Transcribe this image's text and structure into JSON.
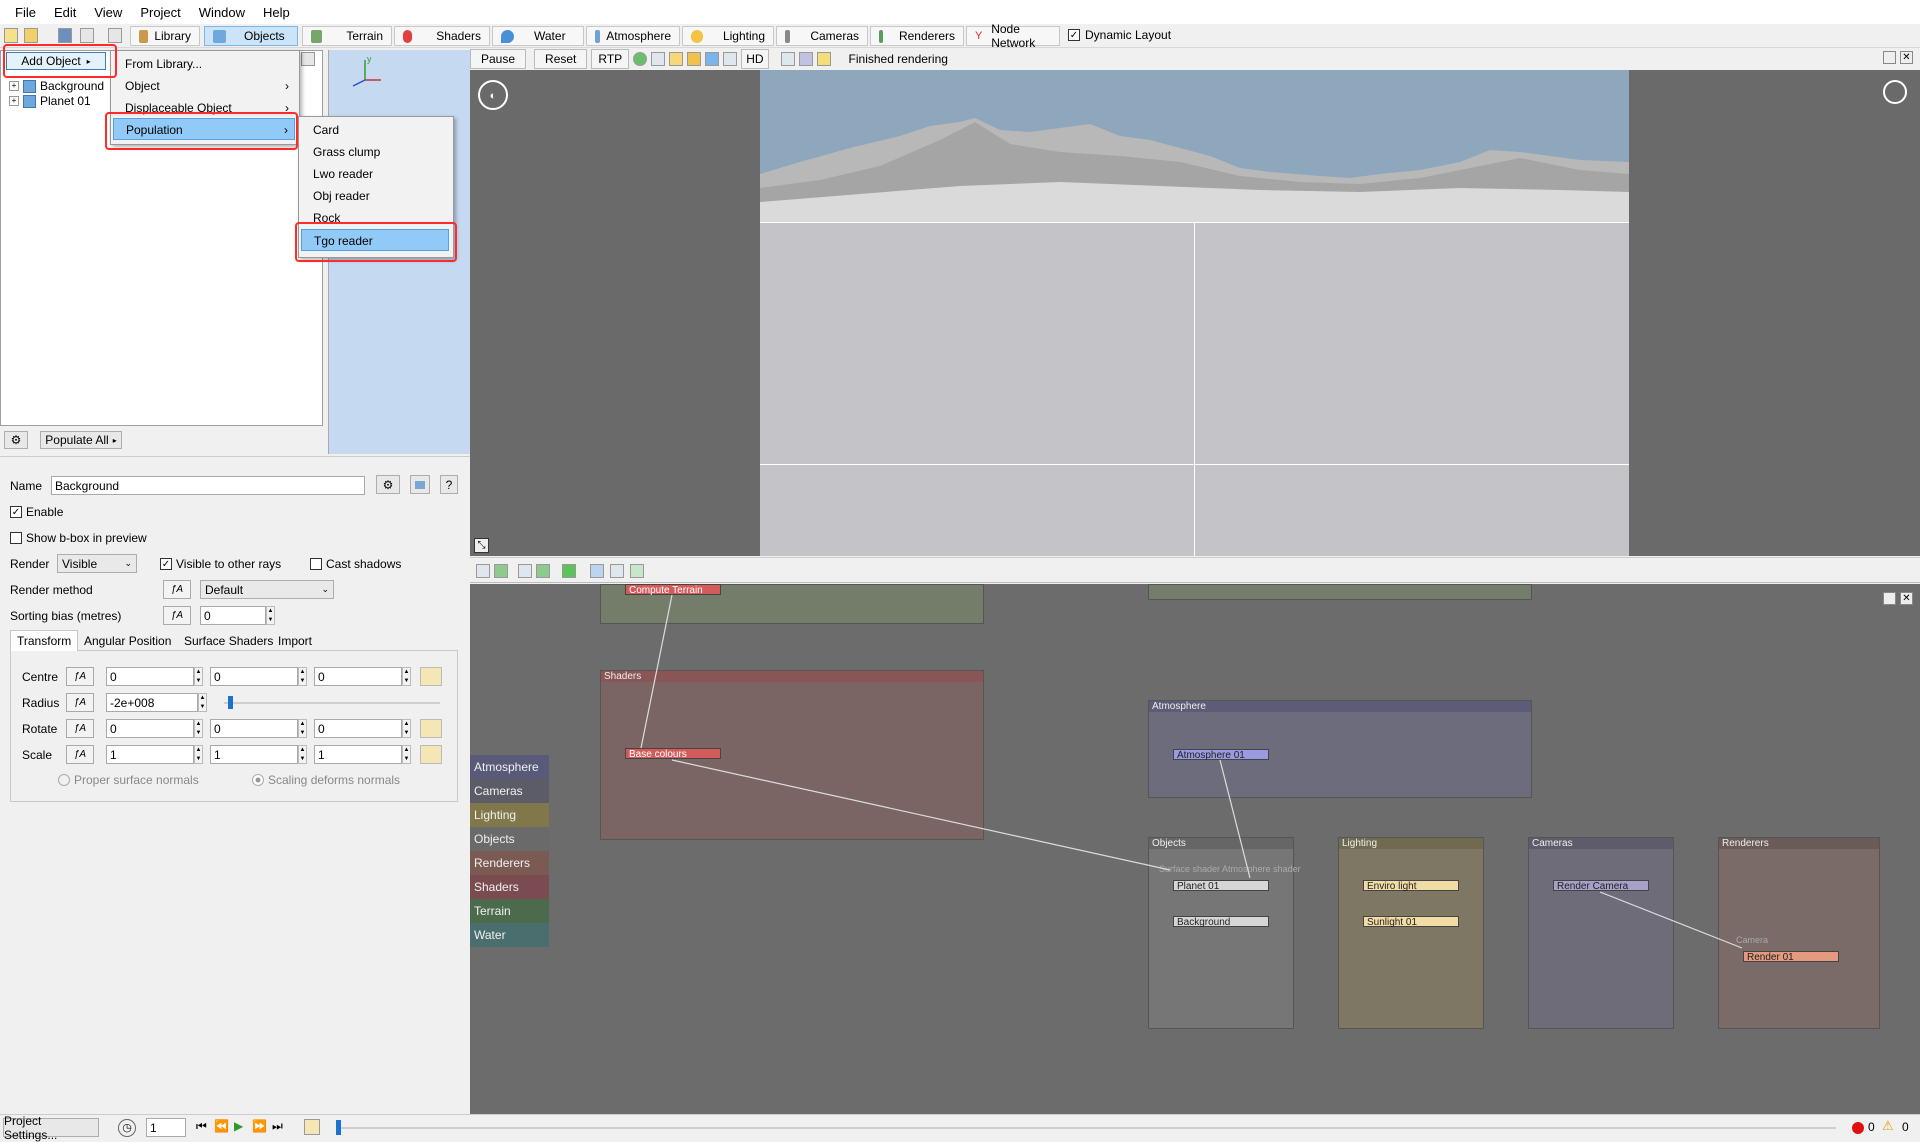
{
  "menubar": [
    "File",
    "Edit",
    "View",
    "Project",
    "Window",
    "Help"
  ],
  "tabs": {
    "library": "Library",
    "objects": "Objects",
    "terrain": "Terrain",
    "shaders": "Shaders",
    "water": "Water",
    "atmosphere": "Atmosphere",
    "lighting": "Lighting",
    "cameras": "Cameras",
    "renderers": "Renderers",
    "node_network": "Node Network",
    "dynamic_layout": "Dynamic Layout"
  },
  "render_controls": {
    "pause": "Pause",
    "reset": "Reset",
    "rtp": "RTP",
    "hd": "HD",
    "status": "Finished rendering"
  },
  "tree": {
    "add_object": "Add Object",
    "items": [
      "Background",
      "Planet 01"
    ],
    "populate_all": "Populate All"
  },
  "context_menu": {
    "items": [
      "From Library...",
      "Object",
      "Displaceable Object",
      "Population"
    ]
  },
  "population_menu": {
    "items": [
      "Card",
      "Grass clump",
      "Lwo reader",
      "Obj reader",
      "Rock",
      "Tgo reader"
    ]
  },
  "properties": {
    "name_label": "Name",
    "name_value": "Background",
    "enable": "Enable",
    "show_bbox": "Show b-box in preview",
    "render_label": "Render",
    "render_value": "Visible",
    "visible_rays": "Visible to other rays",
    "cast_shadows": "Cast shadows",
    "render_method_label": "Render method",
    "render_method_value": "Default",
    "sorting_bias_label": "Sorting bias (metres)",
    "sorting_bias_value": "0",
    "subtabs": [
      "Transform",
      "Angular Position",
      "Surface Shaders",
      "Import"
    ],
    "centre_label": "Centre",
    "centre": [
      "0",
      "0",
      "0"
    ],
    "radius_label": "Radius",
    "radius_value": "-2e+008",
    "rotate_label": "Rotate",
    "rotate": [
      "0",
      "0",
      "0"
    ],
    "scale_label": "Scale",
    "scale": [
      "1",
      "1",
      "1"
    ],
    "proper_normals": "Proper surface normals",
    "scaling_normals": "Scaling deforms normals"
  },
  "node_categories": [
    "Atmosphere",
    "Cameras",
    "Lighting",
    "Objects",
    "Renderers",
    "Shaders",
    "Terrain",
    "Water"
  ],
  "category_colors": [
    "#59597a",
    "#5c5c66",
    "#80784a",
    "#6a6a6a",
    "#7a5a52",
    "#7a4c52",
    "#4c6b4c",
    "#4a6e6e"
  ],
  "node_groups": {
    "shaders": "Shaders",
    "atmosphere": "Atmosphere",
    "objects": "Objects",
    "lighting": "Lighting",
    "cameras": "Cameras",
    "renderers": "Renderers"
  },
  "nodes": {
    "compute_terrain": "Compute Terrain",
    "base_colours": "Base colours",
    "atmosphere01": "Atmosphere 01",
    "planet01": "Planet 01",
    "planet_ports": "Surface shader Atmosphere shader",
    "background": "Background",
    "enviro_light": "Enviro light",
    "sunlight01": "Sunlight 01",
    "render_camera": "Render Camera",
    "camera_port": "Camera",
    "render01": "Render 01"
  },
  "bottombar": {
    "project_settings": "Project Settings...",
    "frame": "1",
    "errors": "0",
    "warnings": "0"
  }
}
